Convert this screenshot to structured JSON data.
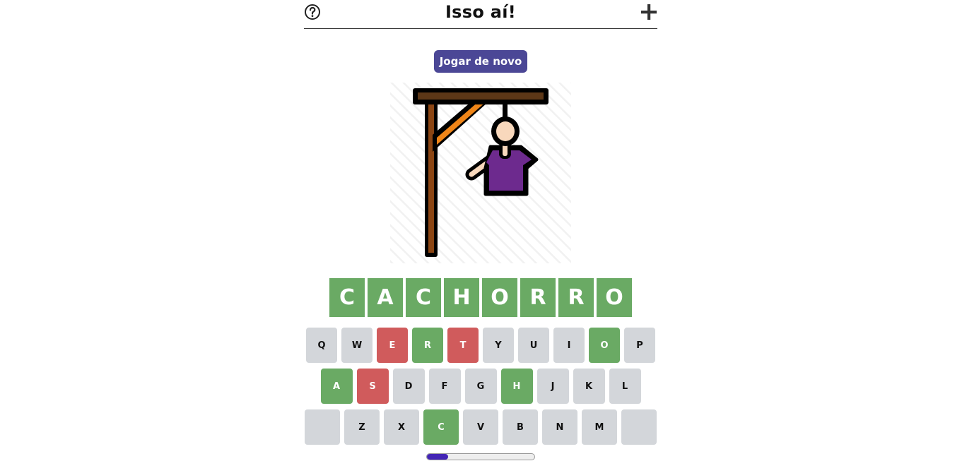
{
  "header": {
    "title": "Isso aí!",
    "help_icon": "question-circle-icon",
    "add_icon": "plus-icon"
  },
  "play_again_label": "Jogar de novo",
  "word": [
    "C",
    "A",
    "C",
    "H",
    "O",
    "R",
    "R",
    "O"
  ],
  "keyboard": {
    "rows": [
      [
        {
          "label": "Q",
          "state": "default"
        },
        {
          "label": "W",
          "state": "default"
        },
        {
          "label": "E",
          "state": "wrong"
        },
        {
          "label": "R",
          "state": "correct"
        },
        {
          "label": "T",
          "state": "wrong"
        },
        {
          "label": "Y",
          "state": "default"
        },
        {
          "label": "U",
          "state": "default"
        },
        {
          "label": "I",
          "state": "default"
        },
        {
          "label": "O",
          "state": "correct"
        },
        {
          "label": "P",
          "state": "default"
        }
      ],
      [
        {
          "label": "A",
          "state": "correct"
        },
        {
          "label": "S",
          "state": "wrong"
        },
        {
          "label": "D",
          "state": "default"
        },
        {
          "label": "F",
          "state": "default"
        },
        {
          "label": "G",
          "state": "default"
        },
        {
          "label": "H",
          "state": "correct"
        },
        {
          "label": "J",
          "state": "default"
        },
        {
          "label": "K",
          "state": "default"
        },
        {
          "label": "L",
          "state": "default"
        }
      ],
      [
        {
          "label": "",
          "state": "default",
          "special": "enter"
        },
        {
          "label": "Z",
          "state": "default"
        },
        {
          "label": "X",
          "state": "default"
        },
        {
          "label": "C",
          "state": "correct"
        },
        {
          "label": "V",
          "state": "default"
        },
        {
          "label": "B",
          "state": "default"
        },
        {
          "label": "N",
          "state": "default"
        },
        {
          "label": "M",
          "state": "default"
        },
        {
          "label": "",
          "state": "default",
          "special": "backspace"
        }
      ]
    ]
  },
  "progress": 0.2,
  "colors": {
    "correct": "#6aaa64",
    "wrong": "#d05b5c",
    "key_default": "#d3d6da",
    "accent": "#4b4796",
    "progress": "#4325b5"
  }
}
